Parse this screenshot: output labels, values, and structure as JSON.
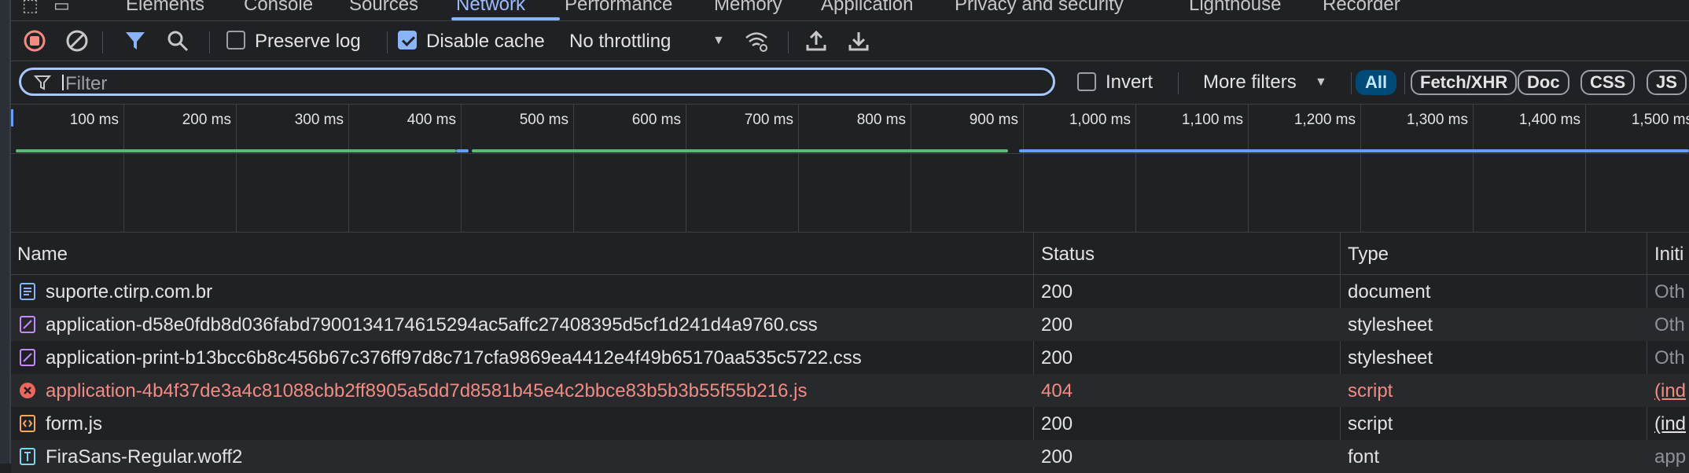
{
  "tabs": [
    {
      "label": "Elements",
      "active": false
    },
    {
      "label": "Console",
      "active": false
    },
    {
      "label": "Sources",
      "active": false
    },
    {
      "label": "Network",
      "active": true
    },
    {
      "label": "Performance",
      "active": false
    },
    {
      "label": "Memory",
      "active": false
    },
    {
      "label": "Application",
      "active": false
    },
    {
      "label": "Privacy and security",
      "active": false
    },
    {
      "label": "Lighthouse",
      "active": false
    },
    {
      "label": "Recorder",
      "active": false
    }
  ],
  "toolbar": {
    "preserve_log_label": "Preserve log",
    "preserve_log_checked": false,
    "disable_cache_label": "Disable cache",
    "disable_cache_checked": true,
    "throttling_value": "No throttling"
  },
  "filterbar": {
    "placeholder": "Filter",
    "invert_label": "Invert",
    "more_filters_label": "More filters",
    "type_pills": [
      "All",
      "Fetch/XHR",
      "Doc",
      "CSS",
      "JS"
    ]
  },
  "timeline": {
    "tick_labels": [
      "100 ms",
      "200 ms",
      "300 ms",
      "400 ms",
      "500 ms",
      "600 ms",
      "700 ms",
      "800 ms",
      "900 ms",
      "1,000 ms",
      "1,100 ms",
      "1,200 ms",
      "1,300 ms",
      "1,400 ms",
      "1,500 ms"
    ]
  },
  "table": {
    "headers": [
      "Name",
      "Status",
      "Type",
      "Initi"
    ],
    "rows": [
      {
        "name": "suporte.ctirp.com.br",
        "status": "200",
        "type": "document",
        "initiator": "Oth",
        "icon": "document-icon",
        "error": false
      },
      {
        "name": "application-d58e0fdb8d036fabd7900134174615294ac5affc27408395d5cf1d241d4a9760.css",
        "status": "200",
        "type": "stylesheet",
        "initiator": "Oth",
        "icon": "stylesheet-icon",
        "error": false
      },
      {
        "name": "application-print-b13bcc6b8c456b67c376ff97d8c717cfa9869ea4412e4f49b65170aa535c5722.css",
        "status": "200",
        "type": "stylesheet",
        "initiator": "Oth",
        "icon": "stylesheet-icon",
        "error": false
      },
      {
        "name": "application-4b4f37de3a4c81088cbb2ff8905a5dd7d8581b45e4c2bbce83b5b3b55f55b216.js",
        "status": "404",
        "type": "script",
        "initiator": "(ind",
        "icon": "error-icon",
        "error": true
      },
      {
        "name": "form.js",
        "status": "200",
        "type": "script",
        "initiator": "(ind",
        "icon": "script-icon",
        "error": false
      },
      {
        "name": "FiraSans-Regular.woff2",
        "status": "200",
        "type": "font",
        "initiator": "app",
        "icon": "font-icon",
        "error": false
      }
    ]
  },
  "colors": {
    "accent": "#8ab4f8",
    "error": "#f28b82",
    "record": "#f28b82",
    "filter_active": "#004a77"
  }
}
